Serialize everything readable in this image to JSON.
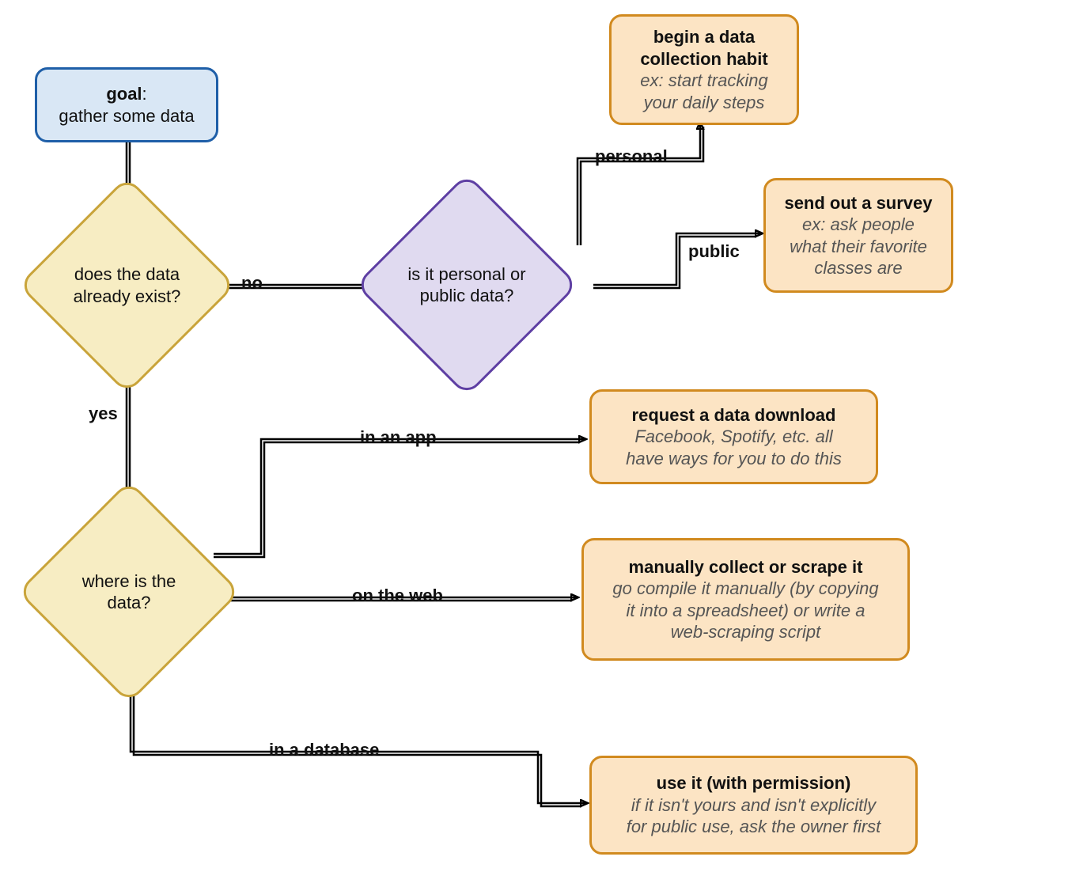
{
  "nodes": {
    "goal": {
      "title": "goal",
      "subtitle": ": \n gather some data"
    },
    "exist": {
      "text": "does the data\nalready exist?"
    },
    "personal_public": {
      "text": "is it personal or\npublic data?"
    },
    "where": {
      "text": "where is the\ndata?"
    },
    "habit": {
      "title": "begin a data\ncollection habit",
      "sub": "ex: start tracking\nyour daily steps"
    },
    "survey": {
      "title": "send out a survey",
      "sub": "ex: ask people\nwhat their favorite\nclasses are"
    },
    "download": {
      "title": "request a data download",
      "sub": "Facebook, Spotify, etc. all\nhave ways for you to do this"
    },
    "scrape": {
      "title": "manually collect or scrape it",
      "sub": "go compile it manually (by copying\nit into a spreadsheet) or write a\nweb-scraping script"
    },
    "useit": {
      "title": "use it (with permission)",
      "sub": "if it isn't yours and isn't explicitly\nfor public use, ask the owner first"
    }
  },
  "edges": {
    "no": "no",
    "yes": "yes",
    "personal": "personal",
    "public": "public",
    "in_app": "in an app",
    "on_web": "on the web",
    "in_db": "in a database"
  },
  "colors": {
    "blue_fill": "#d9e7f5",
    "blue_stroke": "#1f5fa8",
    "orange_fill": "#fce4c4",
    "orange_stroke": "#d18a1f",
    "yellow_fill": "#f7edc3",
    "yellow_stroke": "#c9a43a",
    "purple_fill": "#e0daf0",
    "purple_stroke": "#5e3fa3"
  }
}
